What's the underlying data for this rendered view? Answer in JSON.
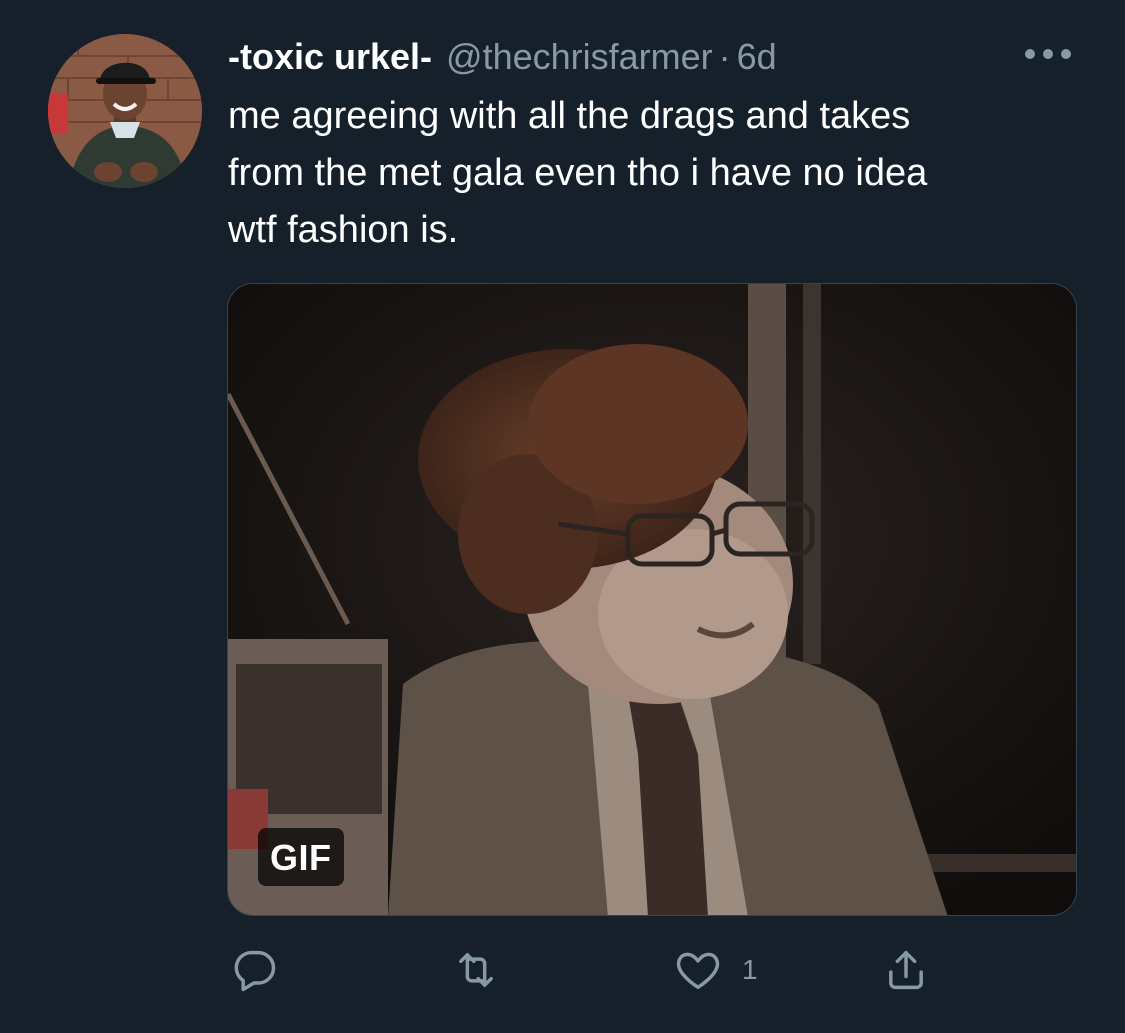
{
  "tweet": {
    "display_name": "-toxic urkel-",
    "handle": "@thechrisfarmer",
    "separator": "·",
    "time": "6d",
    "text": "me agreeing with all the drags and takes\nfrom the met gala even tho i have no idea\nwtf fashion is.",
    "media": {
      "badge": "GIF"
    },
    "actions": {
      "reply_count": "",
      "retweet_count": "",
      "like_count": "1"
    }
  },
  "icons": {
    "more": "more-horizontal-icon",
    "reply": "reply-icon",
    "retweet": "retweet-icon",
    "like": "heart-icon",
    "share": "share-icon"
  },
  "colors": {
    "background": "#15202b",
    "secondary_text": "#8899a6",
    "primary_text": "#ffffff"
  }
}
